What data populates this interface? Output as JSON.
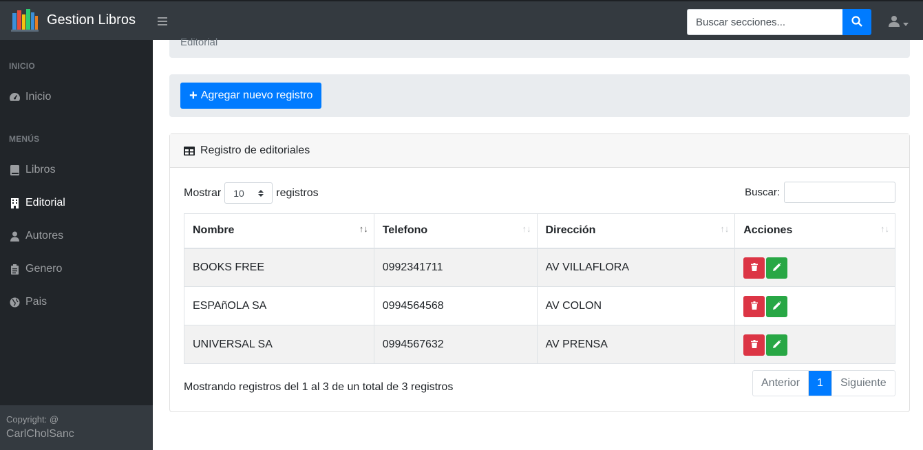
{
  "app": {
    "title": "Gestion Libros"
  },
  "search": {
    "placeholder": "Buscar secciones..."
  },
  "sidebar": {
    "headings": [
      "INICIO",
      "MENÚS"
    ],
    "items": [
      {
        "label": "Inicio",
        "icon": "dashboard-icon"
      },
      {
        "label": "Libros",
        "icon": "book-icon"
      },
      {
        "label": "Editorial",
        "icon": "building-icon",
        "active": true
      },
      {
        "label": "Autores",
        "icon": "user-icon"
      },
      {
        "label": "Genero",
        "icon": "clipboard-icon"
      },
      {
        "label": "Pais",
        "icon": "globe-icon"
      }
    ],
    "footer": {
      "line1": "Copyright: @",
      "line2": "CarlCholSanc"
    }
  },
  "breadcrumb": {
    "label": "Editorial"
  },
  "toolbar": {
    "add_label": "Agregar nuevo registro"
  },
  "card": {
    "title": "Registro de editoriales"
  },
  "table_controls": {
    "show_label": "Mostrar",
    "page_length": "10",
    "records_label": "registros",
    "filter_label": "Buscar:"
  },
  "table": {
    "columns": [
      "Nombre",
      "Telefono",
      "Dirección",
      "Acciones"
    ],
    "rows": [
      {
        "nombre": "BOOKS FREE",
        "telefono": "0992341711",
        "direccion": "AV VILLAFLORA"
      },
      {
        "nombre": "ESPAñOLA SA",
        "telefono": "0994564568",
        "direccion": "AV COLON"
      },
      {
        "nombre": "UNIVERSAL SA",
        "telefono": "0994567632",
        "direccion": "AV PRENSA"
      }
    ]
  },
  "footer_info": "Mostrando registros del 1 al 3 de un total de 3 registros",
  "pagination": {
    "prev": "Anterior",
    "current": "1",
    "next": "Siguiente"
  },
  "colors": {
    "primary": "#007bff",
    "danger": "#dc3545",
    "success": "#28a745",
    "navbar": "#343a40",
    "sidebar": "#212529"
  }
}
